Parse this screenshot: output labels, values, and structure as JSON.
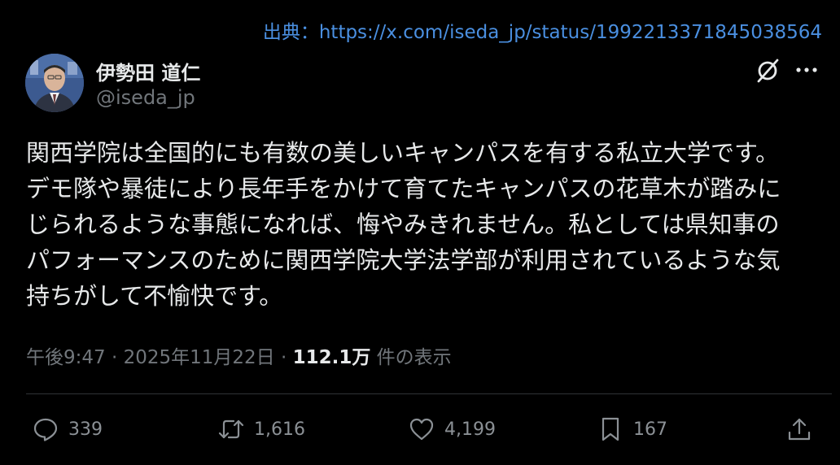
{
  "source": {
    "label": "出典：",
    "url": "https://x.com/iseda_jp/status/1992213371845038564"
  },
  "author": {
    "name": "伊勢田 道仁",
    "handle": "@iseda_jp"
  },
  "post": {
    "lines": [
      "関西学院は全国的にも有数の美しいキャンパスを有する私立大学です。",
      "デモ隊や暴徒により長年手をかけて育てたキャンパスの花草木が踏みに",
      "じられるような事態になれば、悔やみきれません。私としては県知事の",
      "パフォーマンスのために関西学院大学法学部が利用されているような気",
      "持ちがして不愉快です。"
    ]
  },
  "meta": {
    "time": "午後9:47",
    "sep1": " · ",
    "date": "2025年11月22日",
    "sep2": " · ",
    "views": "112.1万",
    "views_label": " 件の表示"
  },
  "actions": {
    "replies": "339",
    "reposts": "1,616",
    "likes": "4,199",
    "bookmarks": "167"
  },
  "icons": [
    "grok-icon",
    "more-icon",
    "reply-icon",
    "repost-icon",
    "like-icon",
    "bookmark-icon",
    "share-icon"
  ],
  "colors": {
    "background": "#000000",
    "text": "#e7e9ea",
    "muted": "#71767b",
    "link": "#4a8fe0",
    "divider": "#2f3336"
  }
}
